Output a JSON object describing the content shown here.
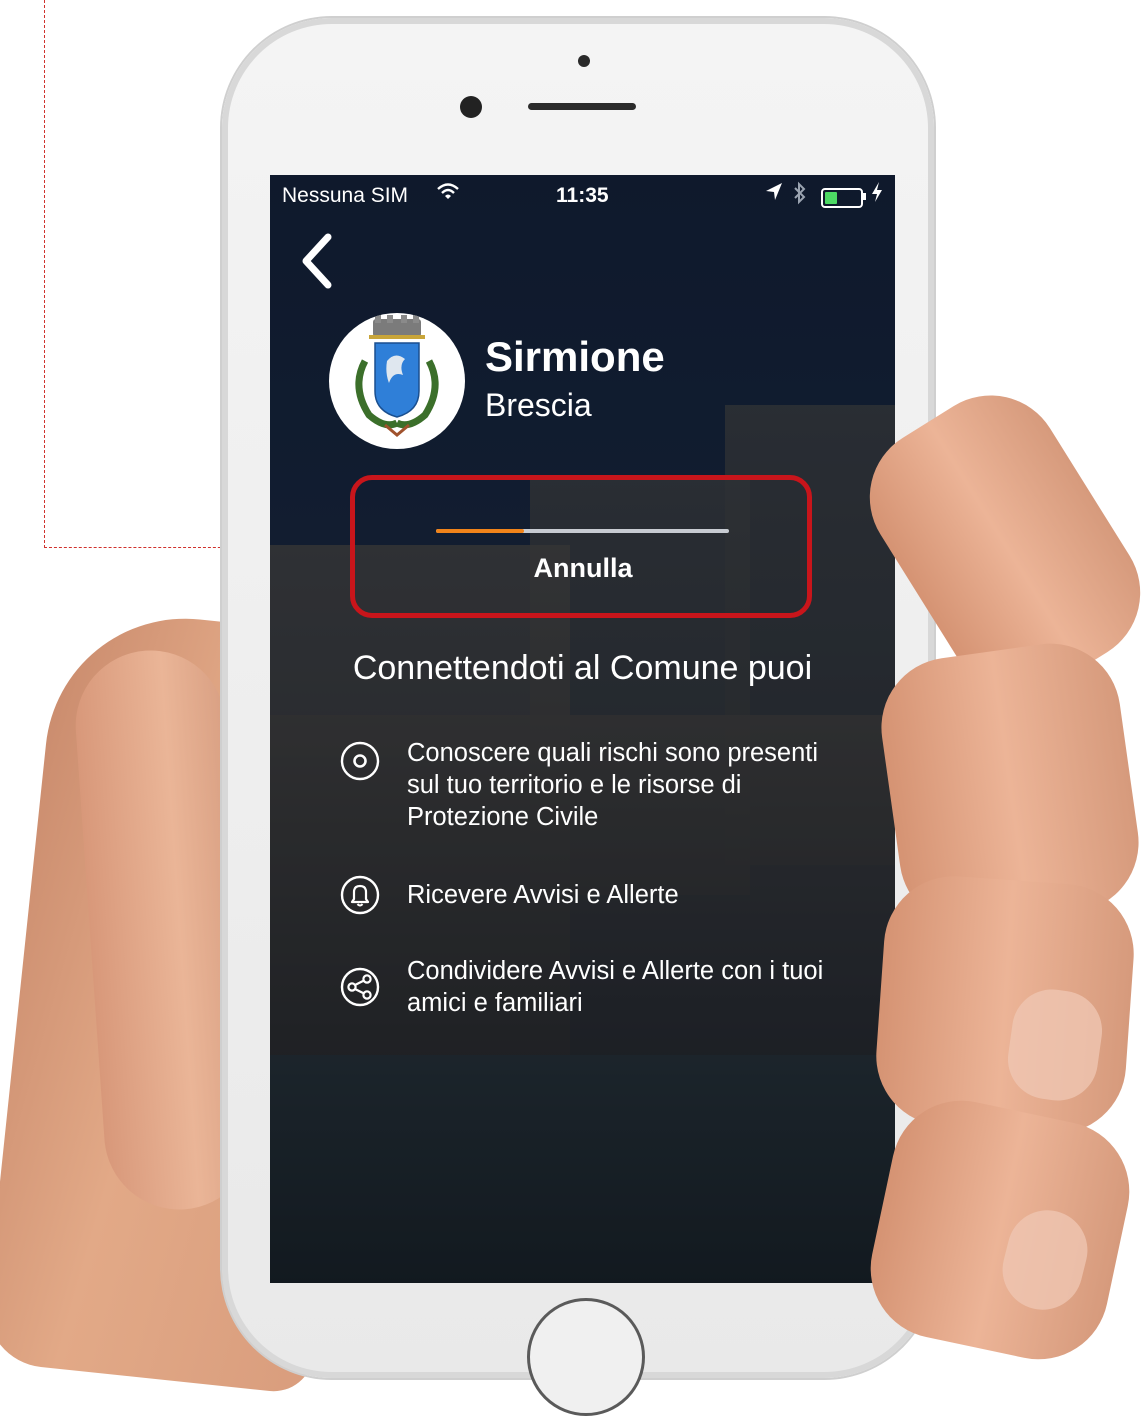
{
  "status_bar": {
    "carrier": "Nessuna SIM",
    "time": "11:35",
    "battery_level": 0.35
  },
  "header": {
    "city": "Sirmione",
    "province": "Brescia"
  },
  "connect": {
    "progress": 0.3,
    "cancel_label": "Annulla"
  },
  "features": {
    "title": "Connettendoti al Comune puoi",
    "items": [
      {
        "icon": "radio-target-icon",
        "text": "Conoscere quali rischi sono presenti sul tuo territorio e le risorse di Protezione Civile"
      },
      {
        "icon": "bell-icon",
        "text": "Ricevere Avvisi e Allerte"
      },
      {
        "icon": "share-icon",
        "text": "Condividere Avvisi e Allerte con i tuoi amici e familiari"
      }
    ]
  },
  "colors": {
    "progress": "#f0831a",
    "highlight": "#c8151b",
    "battery": "#4cd964"
  }
}
